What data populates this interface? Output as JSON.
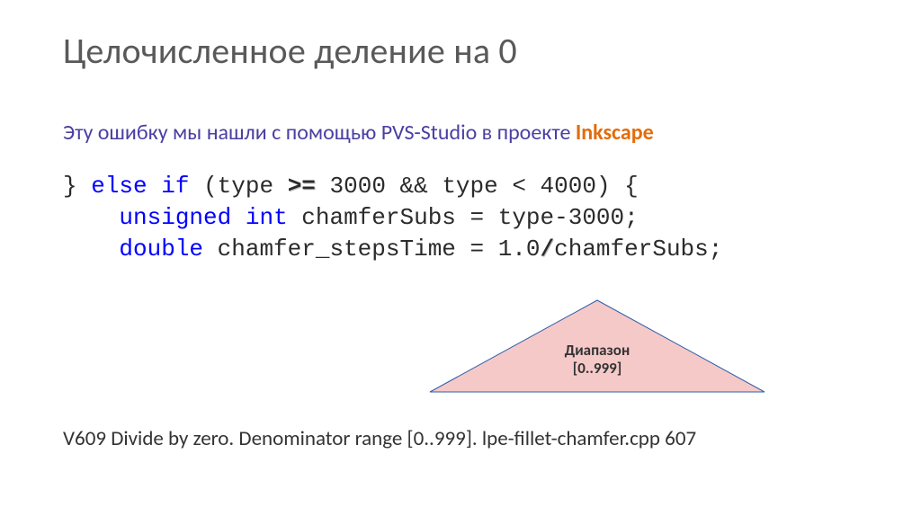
{
  "title": "Целочисленное деление на 0",
  "subtitle_prefix": "Эту ошибку мы нашли с помощью PVS-Studio в проекте ",
  "subtitle_project": "Inkscape",
  "code": {
    "l1_a": "} ",
    "l1_else": "else",
    "l1_b": " ",
    "l1_if": "if",
    "l1_c": " (type ",
    "l1_op1": ">=",
    "l1_d": " 3000 && type < 4000) {",
    "l2_pad": "    ",
    "l2_unsigned": "unsigned",
    "l2_sp": " ",
    "l2_int": "int",
    "l2_rest": " chamferSubs = type-3000;",
    "l3_pad": "    ",
    "l3_double": "double",
    "l3_rest_a": " chamfer_stepsTime = 1.0",
    "l3_op2": "/",
    "l3_rest_b": "chamferSubs;"
  },
  "annotation": {
    "line1": "Диапазон",
    "line2": "[0..999]"
  },
  "diagnostic": "V609 Divide by zero. Denominator range [0..999]. lpe-fillet-chamfer.cpp 607"
}
